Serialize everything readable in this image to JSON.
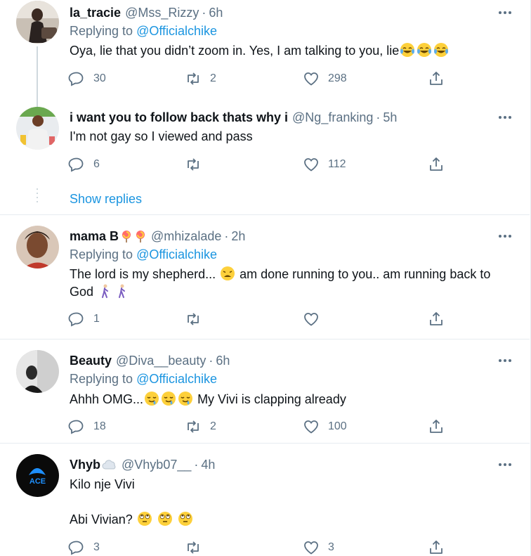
{
  "tweets": [
    {
      "name": "la_tracie",
      "handle": "@Mss_Rizzy",
      "time": "6h",
      "replying_label": "Replying to",
      "replying_handle": "@Officialchike",
      "text": "Oya, lie that you didn’t zoom in. Yes, I am talking to you, lie",
      "text_emoji": "face-with-tears-of-joy x3",
      "replies": "30",
      "retweets": "2",
      "likes": "298"
    },
    {
      "name": "i want you to follow back thats why i",
      "handle": "@Ng_franking",
      "time": "5h",
      "text": "I'm not gay so I viewed and pass",
      "replies": "6",
      "retweets": "",
      "likes": "112"
    },
    {
      "name": "mama B",
      "name_emoji": "lollipop x2",
      "handle": "@mhizalade",
      "time": "2h",
      "replying_label": "Replying to",
      "replying_handle": "@Officialchike",
      "text_line1": "The lord is my shepherd...",
      "text_line1b": "am done running to you.. am running back to",
      "text_line2": "God",
      "text_emoji": "weary-face, person-walking x2",
      "replies": "1",
      "retweets": "",
      "likes": ""
    },
    {
      "name": "Beauty",
      "handle": "@Diva__beauty",
      "time": "6h",
      "replying_label": "Replying to",
      "replying_handle": "@Officialchike",
      "text_a": "Ahhh OMG...",
      "text_b": "My Vivi is clapping already",
      "text_emoji": "drooling-face x3",
      "replies": "18",
      "retweets": "2",
      "likes": "100"
    },
    {
      "name": "Vhyb",
      "name_emoji": "cloud",
      "handle": "@Vhyb07__",
      "time": "4h",
      "text_line1": "Kilo nje Vivi",
      "text_line2": "Abi Vivian?",
      "text_emoji": "face-with-rolling-eyes x3",
      "avatar_text": "ACE",
      "replies": "3",
      "retweets": "",
      "likes": "3"
    }
  ],
  "show_replies": "Show replies",
  "dot": "·",
  "colors": {
    "link": "#1b95e0",
    "secondary_text": "#5b7083",
    "divider": "#e6ecf0",
    "thread_line": "#cfd9de"
  },
  "icons": [
    "reply-icon",
    "retweet-icon",
    "like-icon",
    "share-icon",
    "more-icon"
  ]
}
